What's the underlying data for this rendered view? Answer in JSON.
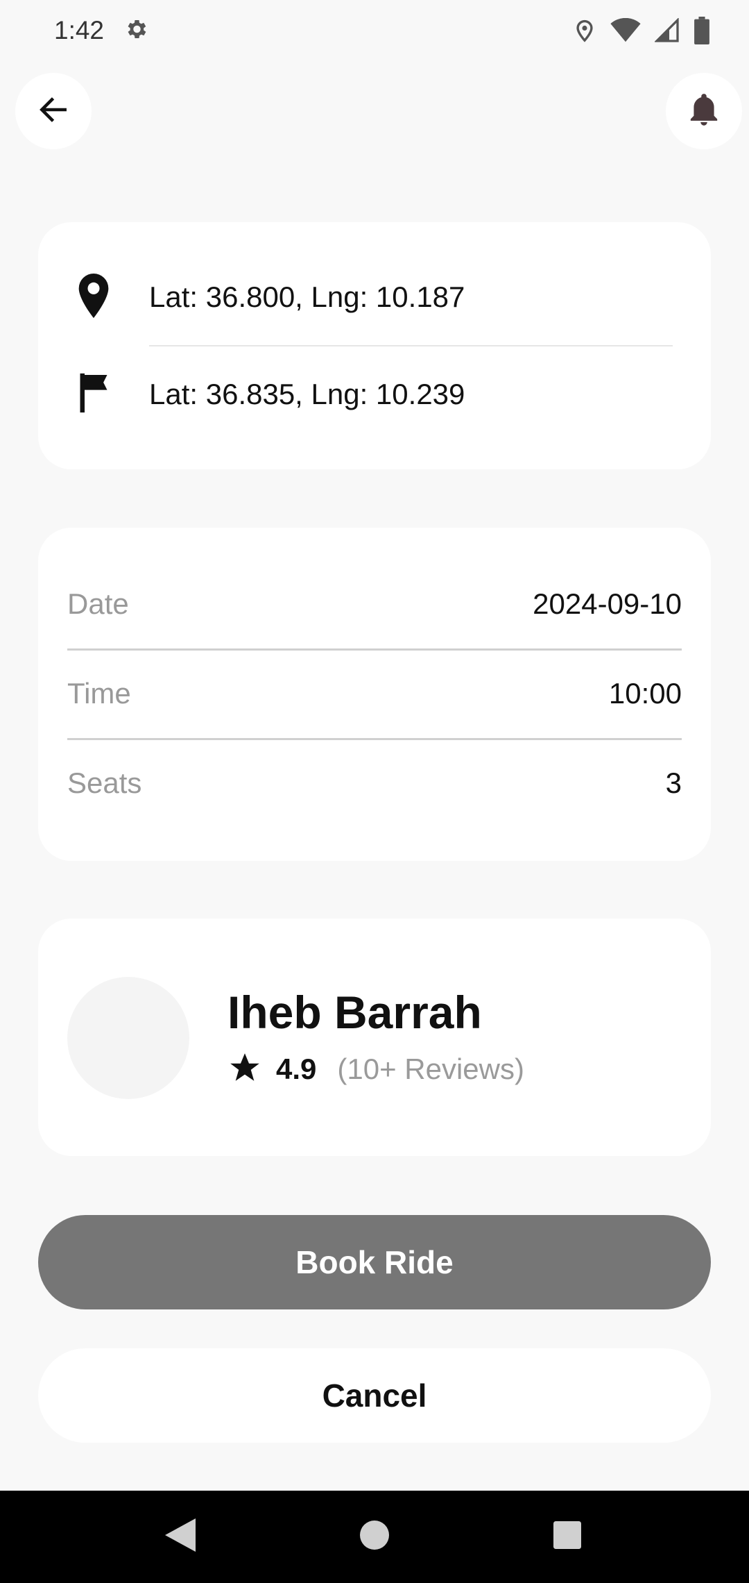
{
  "status_bar": {
    "time": "1:42",
    "icons": [
      "settings-icon",
      "location-icon",
      "wifi-icon",
      "signal-icon",
      "battery-icon"
    ]
  },
  "header": {
    "back_icon": "arrow-back-icon",
    "notification_icon": "bell-icon"
  },
  "route": {
    "from": {
      "icon": "location-pin-icon",
      "text": "Lat: 36.800, Lng: 10.187"
    },
    "to": {
      "icon": "flag-icon",
      "text": "Lat: 36.835, Lng: 10.239"
    }
  },
  "details": [
    {
      "label": "Date",
      "value": "2024-09-10"
    },
    {
      "label": "Time",
      "value": "10:00"
    },
    {
      "label": "Seats",
      "value": "3"
    }
  ],
  "driver": {
    "name": "Iheb Barrah",
    "rating": "4.9",
    "reviews": "(10+ Reviews)"
  },
  "actions": {
    "book_label": "Book Ride",
    "cancel_label": "Cancel"
  },
  "colors": {
    "background": "#f8f8f8",
    "card": "#ffffff",
    "book_button": "#767676",
    "label_gray": "#999999",
    "bell": "#4a3a3d"
  }
}
